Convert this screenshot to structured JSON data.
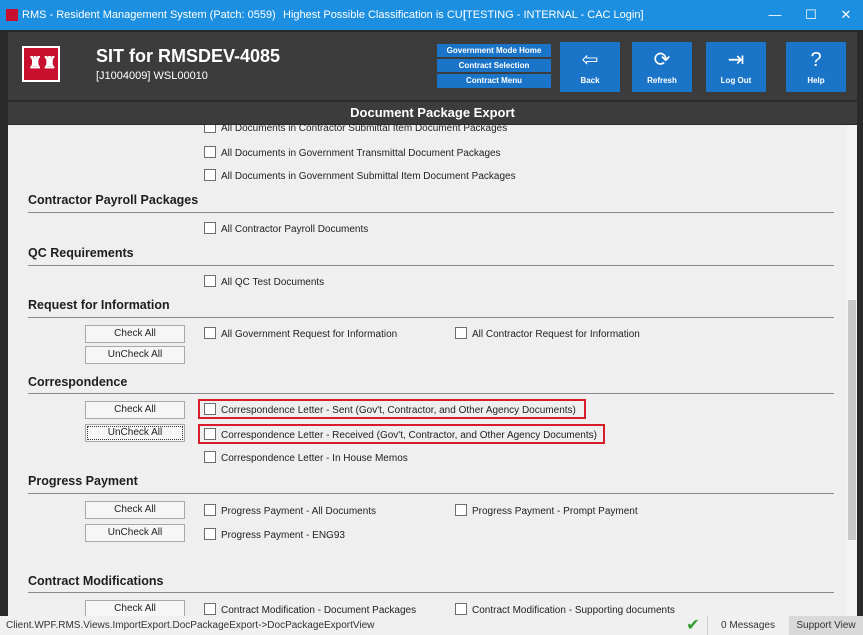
{
  "window": {
    "title": "RMS - Resident Management System (Patch: 0559)",
    "classification": "Highest Possible Classification is CUI",
    "environment": "[TESTING - INTERNAL - CAC Login]",
    "minimize": "—",
    "maximize": "☐",
    "close": "✕"
  },
  "header": {
    "title": "SIT for RMSDEV-4085",
    "subtitle": "[J1004009] WSL00010",
    "nav": {
      "gov_home": "Government Mode Home",
      "contract_selection": "Contract Selection",
      "contract_menu": "Contract Menu"
    },
    "buttons": {
      "back": "Back",
      "refresh": "Refresh",
      "logout": "Log Out",
      "help": "Help"
    },
    "icons": {
      "back": "⇦",
      "refresh": "⟳",
      "logout": "⇥",
      "help": "?"
    }
  },
  "page_title": "Document Package Export",
  "content": {
    "top_items": [
      "All Documents in Contractor Submittal Item Document Packages",
      "All Documents in Government Transmittal Document Packages",
      "All Documents in Government Submittal Item Document Packages"
    ],
    "sections": {
      "payroll": {
        "title": "Contractor Payroll Packages",
        "item": "All Contractor Payroll Documents"
      },
      "qc": {
        "title": "QC Requirements",
        "item": "All QC Test Documents"
      },
      "rfi": {
        "title": "Request for Information",
        "check_all": "Check All",
        "uncheck_all": "UnCheck All",
        "items": [
          "All Government Request for Information",
          "All Contractor Request for Information"
        ]
      },
      "correspondence": {
        "title": "Correspondence",
        "check_all": "Check All",
        "uncheck_all": "UnCheck All",
        "items": [
          "Correspondence Letter - Sent (Gov't, Contractor, and Other Agency Documents)",
          "Correspondence Letter - Received (Gov't, Contractor, and Other Agency Documents)",
          "Correspondence Letter - In House Memos"
        ]
      },
      "progress": {
        "title": "Progress Payment",
        "check_all": "Check All",
        "uncheck_all": "UnCheck All",
        "items": [
          "Progress Payment - All Documents",
          "Progress Payment - Prompt Payment",
          "Progress Payment - ENG93"
        ]
      },
      "modifications": {
        "title": "Contract Modifications",
        "check_all": "Check All",
        "items": [
          "Contract Modification - Document Packages",
          "Contract Modification - Supporting documents"
        ]
      }
    }
  },
  "status": {
    "path": "Client.WPF.RMS.Views.ImportExport.DocPackageExport->DocPackageExportView",
    "messages": "0 Messages",
    "support": "Support View",
    "check_icon": "✔"
  },
  "colors": {
    "titlebar": "#1c8fe0",
    "header": "#3c3c3c",
    "button_blue": "#1a75c9",
    "highlight_red": "#d61e2a"
  }
}
